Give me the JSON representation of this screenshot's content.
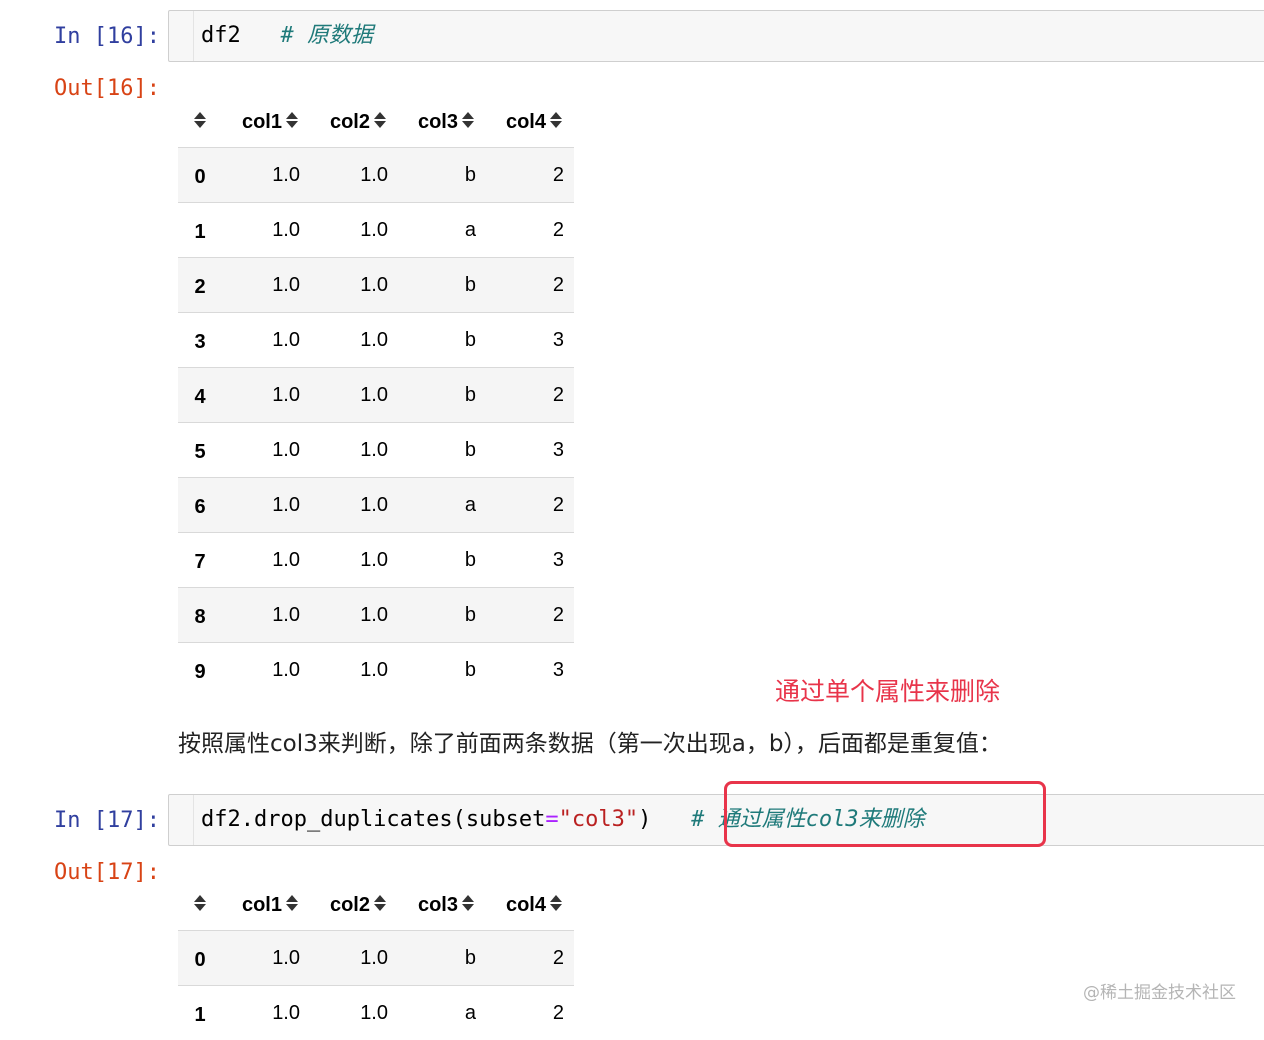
{
  "cell16": {
    "in_prompt": "In [16]:",
    "code": "df2",
    "comment": "# 原数据",
    "out_prompt": "Out[16]:"
  },
  "table16": {
    "columns": [
      "col1",
      "col2",
      "col3",
      "col4"
    ],
    "rows": [
      {
        "index": "0",
        "values": [
          "1.0",
          "1.0",
          "b",
          "2"
        ]
      },
      {
        "index": "1",
        "values": [
          "1.0",
          "1.0",
          "a",
          "2"
        ]
      },
      {
        "index": "2",
        "values": [
          "1.0",
          "1.0",
          "b",
          "2"
        ]
      },
      {
        "index": "3",
        "values": [
          "1.0",
          "1.0",
          "b",
          "3"
        ]
      },
      {
        "index": "4",
        "values": [
          "1.0",
          "1.0",
          "b",
          "2"
        ]
      },
      {
        "index": "5",
        "values": [
          "1.0",
          "1.0",
          "b",
          "3"
        ]
      },
      {
        "index": "6",
        "values": [
          "1.0",
          "1.0",
          "a",
          "2"
        ]
      },
      {
        "index": "7",
        "values": [
          "1.0",
          "1.0",
          "b",
          "3"
        ]
      },
      {
        "index": "8",
        "values": [
          "1.0",
          "1.0",
          "b",
          "2"
        ]
      },
      {
        "index": "9",
        "values": [
          "1.0",
          "1.0",
          "b",
          "3"
        ]
      }
    ]
  },
  "annotation": "通过单个属性来删除",
  "note": "按照属性col3来判断，除了前面两条数据（第一次出现a，b），后面都是重复值：",
  "cell17": {
    "in_prompt": "In [17]:",
    "code_func": "df2.drop_duplicates(subset",
    "code_op": "=",
    "code_str": "\"col3\"",
    "code_close": ")",
    "comment": "# 通过属性col3来删除",
    "out_prompt": "Out[17]:"
  },
  "table17": {
    "columns": [
      "col1",
      "col2",
      "col3",
      "col4"
    ],
    "rows": [
      {
        "index": "0",
        "values": [
          "1.0",
          "1.0",
          "b",
          "2"
        ]
      },
      {
        "index": "1",
        "values": [
          "1.0",
          "1.0",
          "a",
          "2"
        ]
      }
    ]
  },
  "watermark": "@稀土掘金技术社区",
  "colors": {
    "in_prompt": "#303f9f",
    "out_prompt": "#d84315",
    "comment": "#1f7a7a",
    "highlight": "#e8344a"
  },
  "icons": {
    "sort": "sort-icon"
  }
}
